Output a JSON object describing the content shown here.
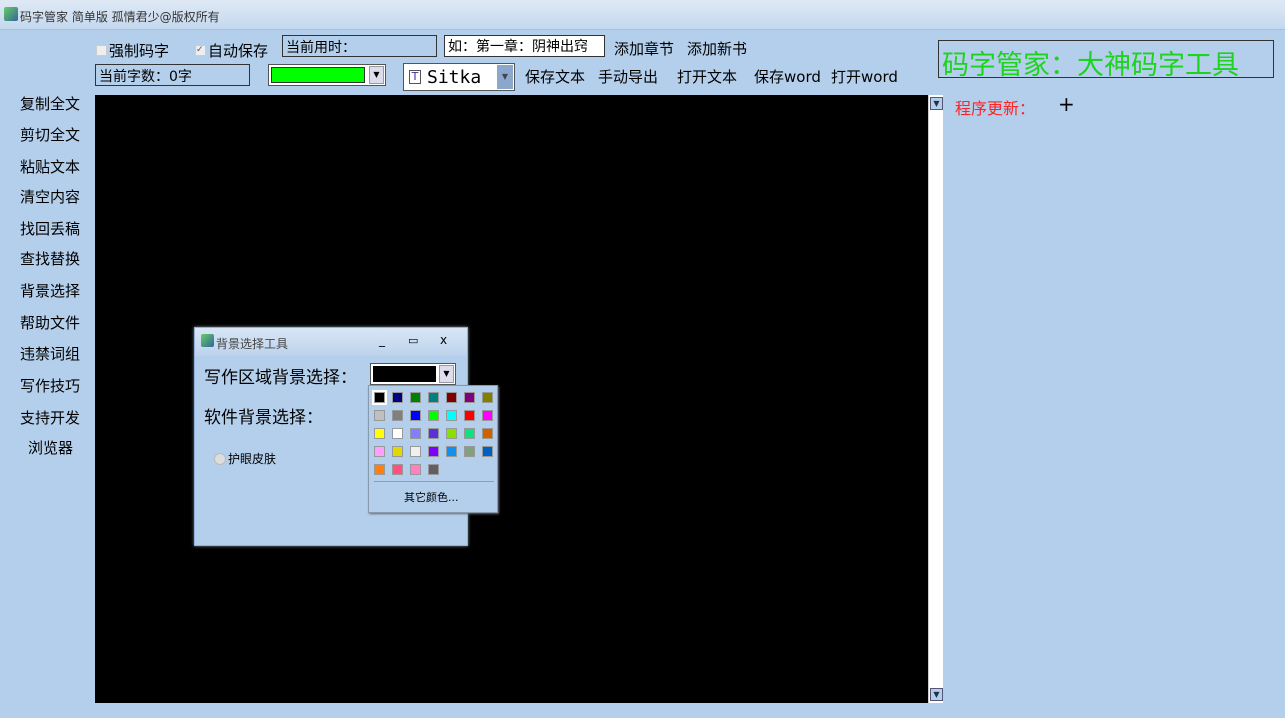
{
  "window": {
    "title": "码字管家 简单版  孤情君少@版权所有"
  },
  "toolbar": {
    "force_typing": "强制码字",
    "force_typing_checked": false,
    "auto_save": "自动保存",
    "auto_save_checked": true,
    "time_used": "当前用时：",
    "chapter_input": "如：第一章：阴神出窍",
    "add_chapter": "添加章节",
    "add_book": "添加新书",
    "word_count": "当前字数：0字",
    "text_color": "#00ff00",
    "font": "Sitka",
    "save_text": "保存文本",
    "manual_export": "手动导出",
    "open_text": "打开文本",
    "save_word": "保存word",
    "open_word": "打开word"
  },
  "brand": "码字管家：大神码字工具",
  "update": {
    "label": "程序更新：",
    "plus": "+"
  },
  "sidebar": {
    "items": [
      {
        "label": "复制全文"
      },
      {
        "label": "剪切全文"
      },
      {
        "label": "粘贴文本"
      },
      {
        "label": "清空内容"
      },
      {
        "label": "找回丢稿"
      },
      {
        "label": "查找替换"
      },
      {
        "label": "背景选择"
      },
      {
        "label": "帮助文件"
      },
      {
        "label": "违禁词组"
      },
      {
        "label": "写作技巧"
      },
      {
        "label": "支持开发"
      },
      {
        "label": "浏览器"
      }
    ]
  },
  "editor": {
    "background": "#000000"
  },
  "dialog": {
    "title": "背景选择工具",
    "writing_bg_label": "写作区域背景选择：",
    "writing_bg_value": "#000000",
    "software_bg_label": "软件背景选择：",
    "eye_care": "护眼皮肤",
    "palette": [
      "#000000",
      "#000080",
      "#008000",
      "#008080",
      "#800000",
      "#800080",
      "#808000",
      "#c0c0c0",
      "#808080",
      "#0000ff",
      "#00ff00",
      "#00ffff",
      "#ff0000",
      "#ff00ff",
      "#ffff00",
      "#ffffff",
      "#8080ff",
      "#5a32d8",
      "#88e000",
      "#10e080",
      "#d06000",
      "#ffa0ff",
      "#e0d800",
      "#f0f0f0",
      "#8000ff",
      "#1090f0",
      "#80a080",
      "#0060c0",
      "#ff8010",
      "#ff5080",
      "#ff80c0",
      "#606060"
    ],
    "more_colors": "其它颜色..."
  }
}
